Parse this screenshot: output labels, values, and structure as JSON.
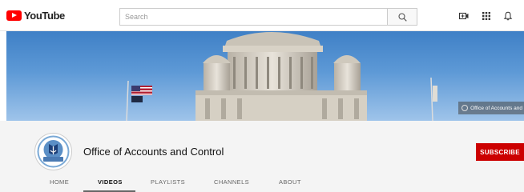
{
  "logo": {
    "text": "YouTube"
  },
  "search": {
    "placeholder": "Search",
    "value": ""
  },
  "icons": {
    "search": "search-icon",
    "upload": "video-camera-icon",
    "apps": "apps-grid-icon",
    "notifications": "bell-icon"
  },
  "banner": {
    "badge": "Office of Accounts and"
  },
  "channel": {
    "title": "Office of Accounts and Control",
    "subscribe_label": "SUBSCRIBE"
  },
  "tabs": [
    {
      "label": "HOME",
      "active": false
    },
    {
      "label": "VIDEOS",
      "active": true
    },
    {
      "label": "PLAYLISTS",
      "active": false
    },
    {
      "label": "CHANNELS",
      "active": false
    },
    {
      "label": "ABOUT",
      "active": false
    }
  ],
  "colors": {
    "brand_red": "#ff0000",
    "subscribe_red": "#cc0000",
    "header_bg": "#f4f4f4"
  }
}
